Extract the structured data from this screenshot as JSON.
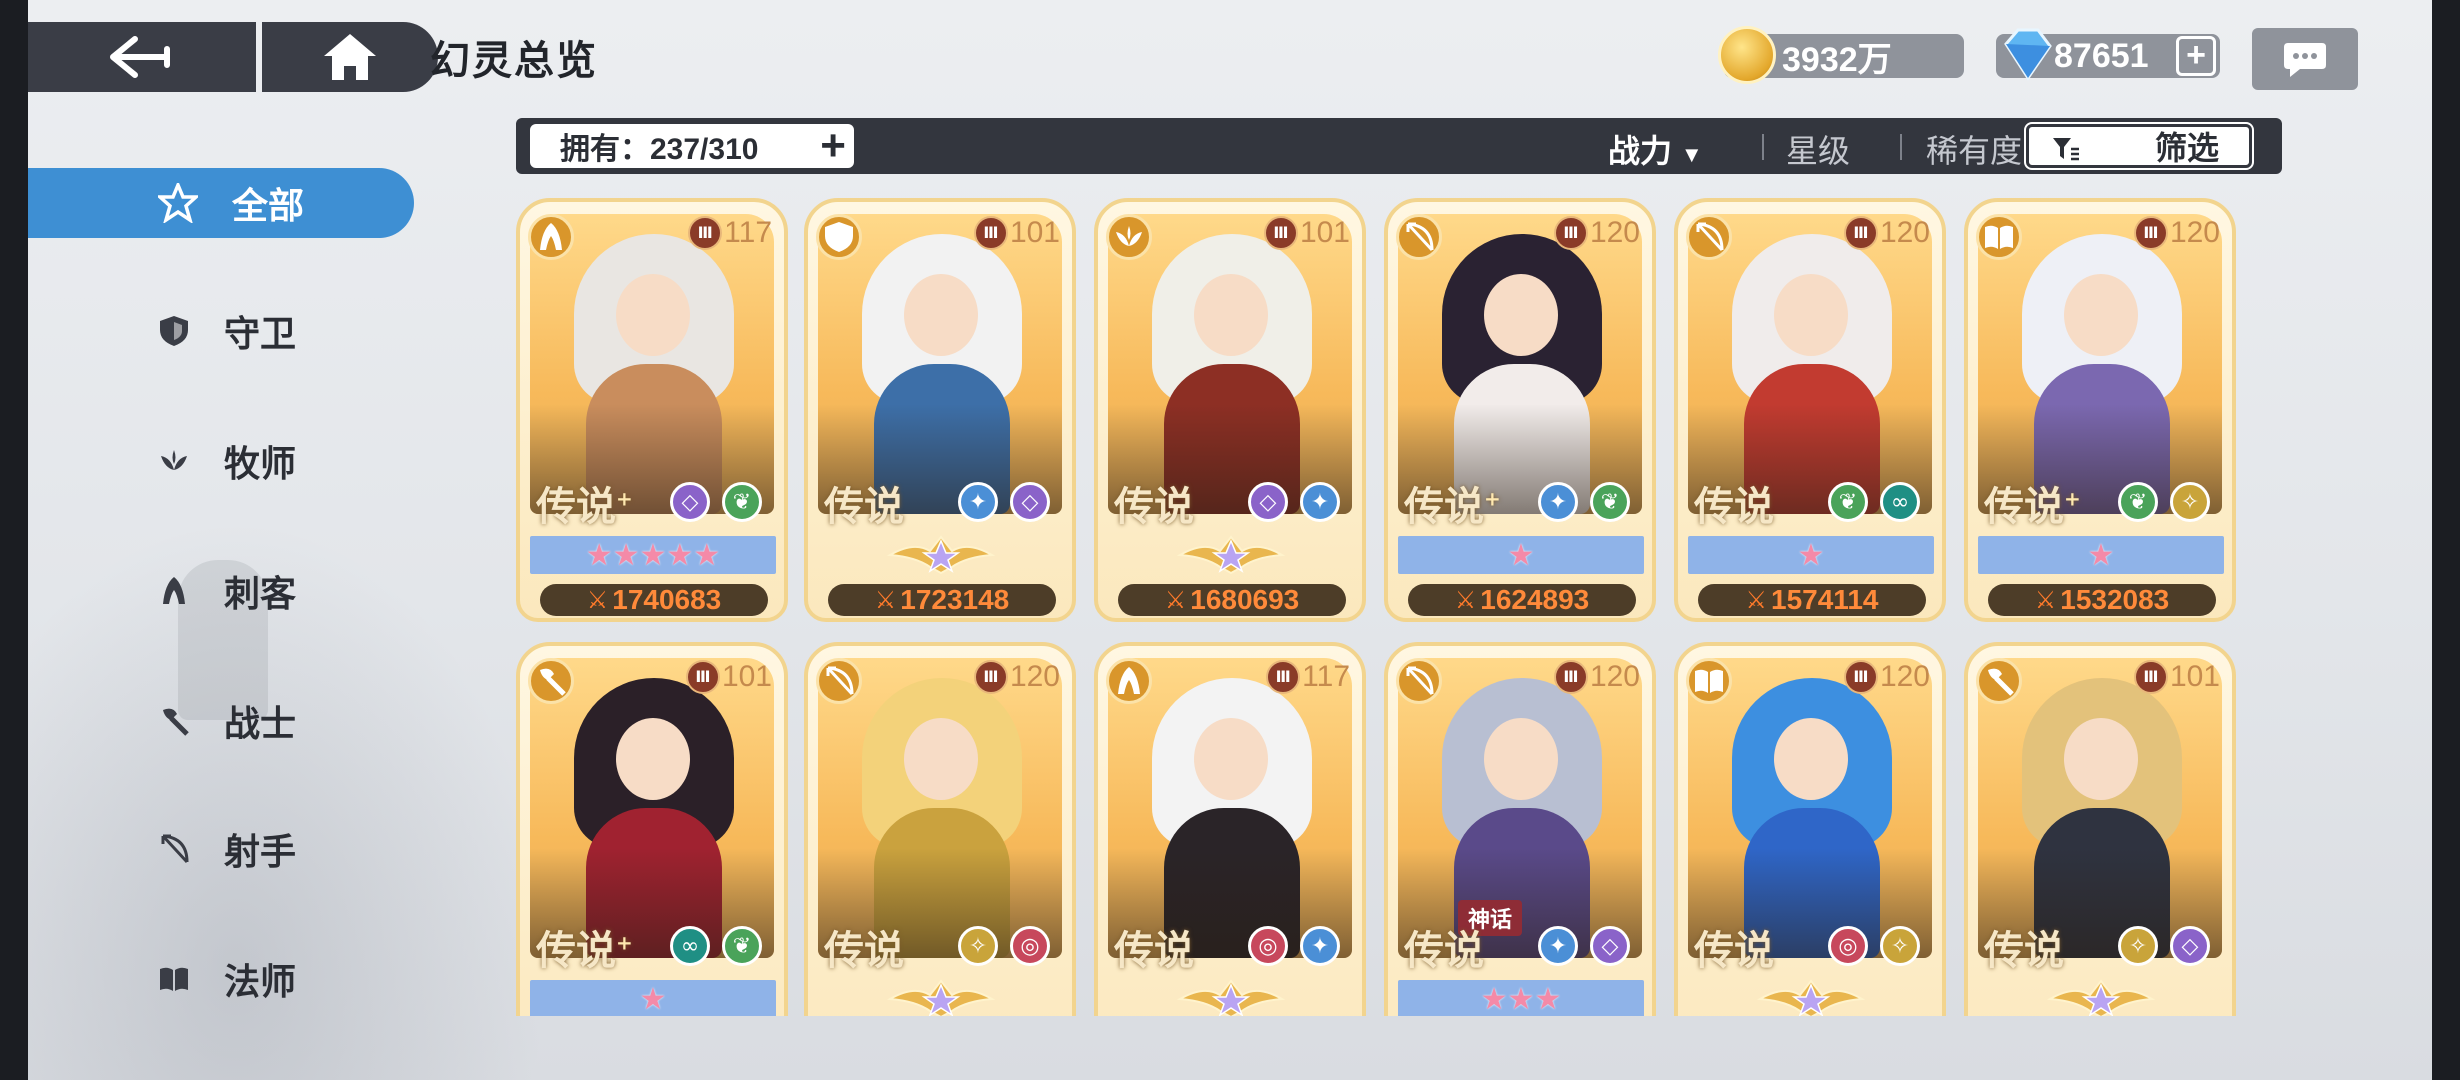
{
  "header": {
    "title": "幻灵总览",
    "gold": "3932万",
    "gems": "87651",
    "gem_plus": "+"
  },
  "sidebar": {
    "items": [
      {
        "label": "全部",
        "icon": "star-icon",
        "active": true
      },
      {
        "label": "守卫",
        "icon": "shield-icon"
      },
      {
        "label": "牧师",
        "icon": "healer-icon"
      },
      {
        "label": "刺客",
        "icon": "assassin-icon"
      },
      {
        "label": "战士",
        "icon": "axe-icon"
      },
      {
        "label": "射手",
        "icon": "bow-icon"
      },
      {
        "label": "法师",
        "icon": "book-icon"
      }
    ]
  },
  "filter_bar": {
    "owned": "拥有：237/310",
    "owned_plus": "+",
    "sort_power": "战力",
    "sort_star": "星级",
    "sort_rarity": "稀有度",
    "filter_label": "筛选"
  },
  "colors": {
    "accent_blue": "#3e8fd3",
    "bar_dark": "#33363e",
    "power_orange": "#ff8a3a",
    "card_gold": "#f2d48e"
  },
  "cards": [
    {
      "level": "117",
      "rarity": "传说",
      "plus": "+",
      "class_icon": "assassin-icon",
      "elements": [
        "void-icon",
        "nature-icon"
      ],
      "stars": "★★★★★",
      "star_type": "pink",
      "power": "1740683",
      "hair": "#e9e6e2",
      "body": "#c98d5d"
    },
    {
      "level": "101",
      "rarity": "传说",
      "plus": "",
      "class_icon": "shield-icon",
      "elements": [
        "ice-icon",
        "void-icon"
      ],
      "stars": "",
      "star_type": "crest",
      "power": "1723148",
      "hair": "#f2f2f2",
      "body": "#3d6fa8"
    },
    {
      "level": "101",
      "rarity": "传说",
      "plus": "",
      "class_icon": "healer-icon",
      "elements": [
        "void-icon",
        "ice-icon"
      ],
      "stars": "",
      "star_type": "crest",
      "power": "1680693",
      "hair": "#f0efe8",
      "body": "#8d2f24"
    },
    {
      "level": "120",
      "rarity": "传说",
      "plus": "+",
      "class_icon": "bow-icon",
      "elements": [
        "ice-icon",
        "nature-icon"
      ],
      "stars": "★",
      "star_type": "pink",
      "power": "1624893",
      "hair": "#2a2232",
      "body": "#f2ecea"
    },
    {
      "level": "120",
      "rarity": "传说",
      "plus": "",
      "class_icon": "bow-icon",
      "elements": [
        "nature-icon",
        "teal-icon"
      ],
      "stars": "★",
      "star_type": "pink",
      "power": "1574114",
      "hair": "#f0eceb",
      "body": "#c23b30"
    },
    {
      "level": "120",
      "rarity": "传说",
      "plus": "+",
      "class_icon": "book-icon",
      "elements": [
        "nature-icon",
        "wing-icon"
      ],
      "stars": "★",
      "star_type": "pink",
      "power": "1532083",
      "hair": "#eef0f6",
      "body": "#7b68b0"
    },
    {
      "level": "101",
      "rarity": "传说",
      "plus": "+",
      "class_icon": "axe-icon",
      "elements": [
        "teal-icon",
        "nature-icon"
      ],
      "stars": "★",
      "star_type": "pink",
      "power": "",
      "hair": "#2b2028",
      "body": "#a02230"
    },
    {
      "level": "120",
      "rarity": "传说",
      "plus": "",
      "class_icon": "bow-icon",
      "elements": [
        "wing-icon",
        "swirl-icon"
      ],
      "stars": "",
      "star_type": "crest",
      "power": "",
      "hair": "#f3d27a",
      "body": "#caa23e"
    },
    {
      "level": "117",
      "rarity": "传说",
      "plus": "",
      "class_icon": "assassin-icon",
      "elements": [
        "swirl-icon",
        "ice-icon"
      ],
      "stars": "",
      "star_type": "crest",
      "power": "",
      "hair": "#f3f3f3",
      "body": "#2a2428"
    },
    {
      "level": "120",
      "rarity": "传说",
      "plus": "",
      "class_icon": "bow-icon",
      "elements": [
        "ice-icon",
        "void-icon"
      ],
      "stars": "★★★",
      "star_type": "pink",
      "power": "",
      "hair": "#b8bfd2",
      "body": "#5a4a8a",
      "badge": "神话"
    },
    {
      "level": "120",
      "rarity": "传说",
      "plus": "",
      "class_icon": "book-icon",
      "elements": [
        "swirl-icon",
        "wing-icon"
      ],
      "stars": "",
      "star_type": "crest",
      "power": "",
      "hair": "#3d8fe0",
      "body": "#2f66c8"
    },
    {
      "level": "101",
      "rarity": "传说",
      "plus": "",
      "class_icon": "axe-icon",
      "elements": [
        "wing-icon",
        "void-icon"
      ],
      "stars": "",
      "star_type": "crest",
      "power": "",
      "hair": "#e3c27b",
      "body": "#2f3340"
    }
  ]
}
